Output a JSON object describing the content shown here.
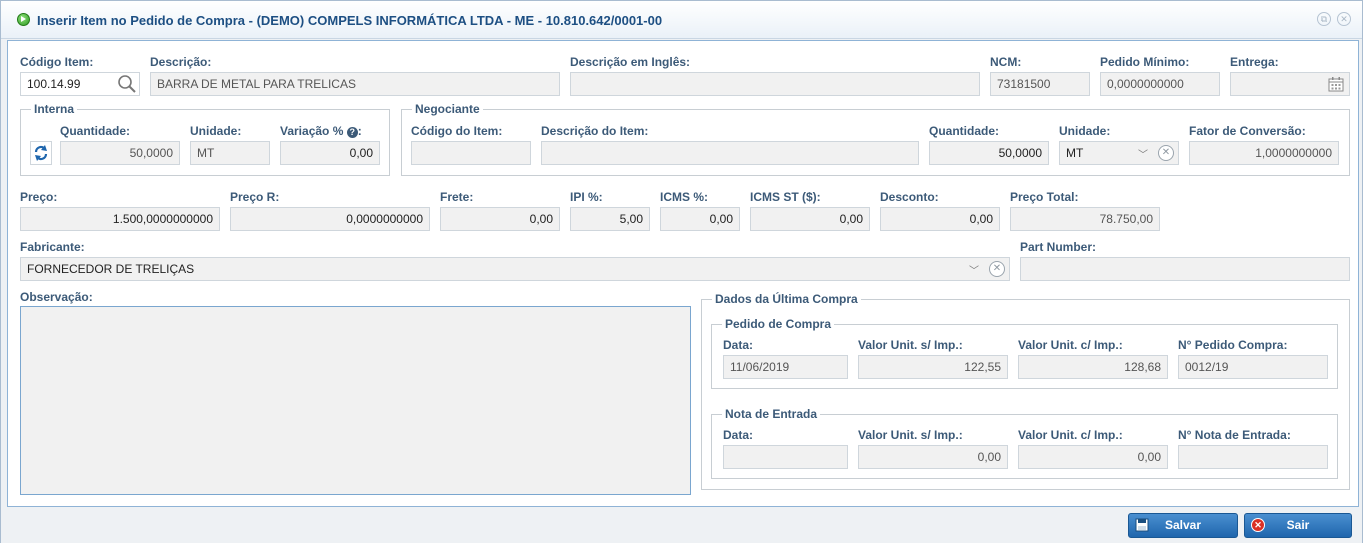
{
  "window": {
    "title": "Inserir Item no Pedido de Compra - (DEMO) COMPELS INFORMÁTICA LTDA - ME - 10.810.642/0001-00"
  },
  "codigo_item": {
    "label": "Código Item:",
    "value": "100.14.99"
  },
  "descricao": {
    "label": "Descrição:",
    "value": "BARRA DE METAL PARA TRELICAS"
  },
  "descricao_ingles": {
    "label": "Descrição em Inglês:",
    "value": ""
  },
  "ncm": {
    "label": "NCM:",
    "value": "73181500"
  },
  "pedido_minimo": {
    "label": "Pedido Mínimo:",
    "value": "0,0000000000"
  },
  "entrega": {
    "label": "Entrega:",
    "value": ""
  },
  "interna": {
    "legend": "Interna",
    "quantidade_label": "Quantidade:",
    "quantidade": "50,0000",
    "unidade_label": "Unidade:",
    "unidade": "MT",
    "variacao_label": "Variação %",
    "variacao": "0,00"
  },
  "negociante": {
    "legend": "Negociante",
    "codigo_label": "Código do Item:",
    "codigo": "",
    "descricao_label": "Descrição do Item:",
    "descricao": "",
    "quantidade_label": "Quantidade:",
    "quantidade": "50,0000",
    "unidade_label": "Unidade:",
    "unidade": "MT",
    "fator_label": "Fator de Conversão:",
    "fator": "1,0000000000"
  },
  "preco": {
    "label": "Preço:",
    "value": "1.500,0000000000"
  },
  "preco_r": {
    "label": "Preço R:",
    "value": "0,0000000000"
  },
  "frete": {
    "label": "Frete:",
    "value": "0,00"
  },
  "ipi": {
    "label": "IPI %:",
    "value": "5,00"
  },
  "icms": {
    "label": "ICMS %:",
    "value": "0,00"
  },
  "icms_st": {
    "label": "ICMS ST ($):",
    "value": "0,00"
  },
  "desconto": {
    "label": "Desconto:",
    "value": "0,00"
  },
  "preco_total": {
    "label": "Preço Total:",
    "value": "78.750,00"
  },
  "fabricante": {
    "label": "Fabricante:",
    "value": "FORNECEDOR DE TRELIÇAS"
  },
  "part_number": {
    "label": "Part Number:",
    "value": ""
  },
  "observacao": {
    "label": "Observação:",
    "value": ""
  },
  "ultima_compra": {
    "legend": "Dados da Última Compra",
    "pedido": {
      "legend": "Pedido de Compra",
      "data_label": "Data:",
      "data": "11/06/2019",
      "vsi_label": "Valor Unit. s/ Imp.:",
      "vsi": "122,55",
      "vci_label": "Valor Unit. c/ Imp.:",
      "vci": "128,68",
      "num_label": "N° Pedido Compra:",
      "num": "0012/19"
    },
    "nota": {
      "legend": "Nota de Entrada",
      "data_label": "Data:",
      "data": "",
      "vsi_label": "Valor Unit. s/ Imp.:",
      "vsi": "0,00",
      "vci_label": "Valor Unit. c/ Imp.:",
      "vci": "0,00",
      "num_label": "N° Nota de Entrada:",
      "num": ""
    }
  },
  "buttons": {
    "save": "Salvar",
    "exit": "Sair"
  }
}
